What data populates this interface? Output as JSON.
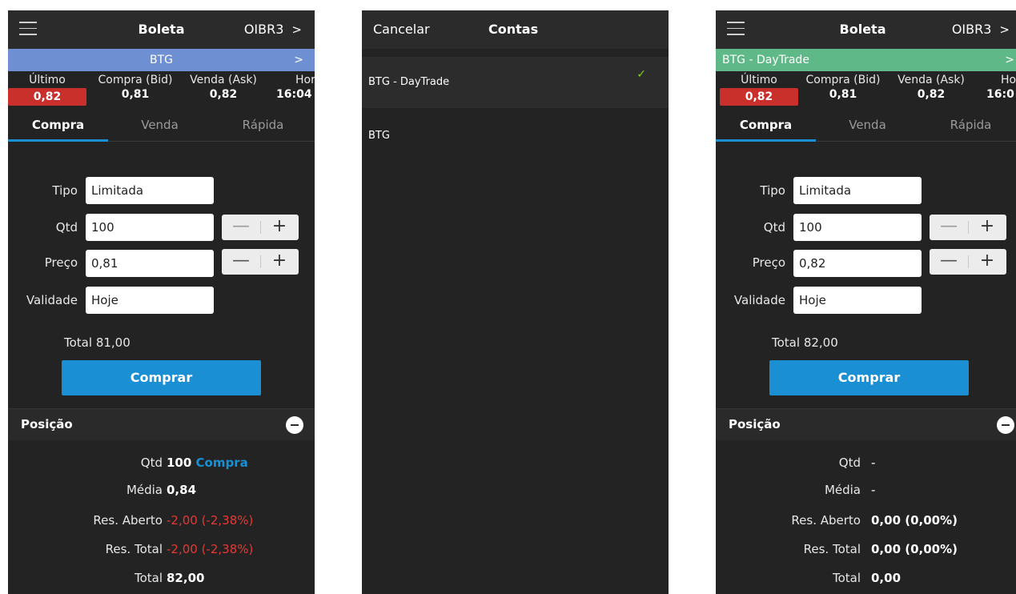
{
  "screen1": {
    "title": "Boleta",
    "ticker": "OIBR3",
    "ticker_chevron": ">",
    "account": "BTG",
    "account_chevron": ">",
    "quotes": {
      "last_label": "Último",
      "last_value": "0,82",
      "bid_label": "Compra (Bid)",
      "bid_value": "0,81",
      "ask_label": "Venda (Ask)",
      "ask_value": "0,82",
      "time_label": "Hor",
      "time_value": "16:04"
    },
    "tabs": [
      "Compra",
      "Venda",
      "Rápida"
    ],
    "form": {
      "tipo_label": "Tipo",
      "tipo_value": "Limitada",
      "qtd_label": "Qtd",
      "qtd_value": "100",
      "preco_label": "Preço",
      "preco_value": "0,81",
      "validade_label": "Validade",
      "validade_value": "Hoje",
      "minus": "—",
      "plus": "+"
    },
    "total_label": "Total",
    "total_value": "81,00",
    "buy_button": "Comprar",
    "position": {
      "title": "Posição",
      "qtd_label": "Qtd",
      "qtd_value": "100",
      "qtd_side": "Compra",
      "media_label": "Média",
      "media_value": "0,84",
      "res_aberto_label": "Res. Aberto",
      "res_aberto_value": "-2,00 (-2,38%)",
      "res_total_label": "Res. Total",
      "res_total_value": "-2,00 (-2,38%)",
      "total_label": "Total",
      "total_value": "82,00"
    }
  },
  "contas": {
    "cancel": "Cancelar",
    "title": "Contas",
    "items": [
      "BTG - DayTrade",
      "BTG"
    ],
    "check": "✓"
  },
  "screen3": {
    "title": "Boleta",
    "ticker": "OIBR3",
    "ticker_chevron": ">",
    "account": "BTG - DayTrade",
    "account_chevron": ">",
    "quotes": {
      "last_label": "Último",
      "last_value": "0,82",
      "bid_label": "Compra (Bid)",
      "bid_value": "0,81",
      "ask_label": "Venda (Ask)",
      "ask_value": "0,82",
      "time_label": "Ho",
      "time_value": "16:0"
    },
    "tabs": [
      "Compra",
      "Venda",
      "Rápida"
    ],
    "form": {
      "tipo_label": "Tipo",
      "tipo_value": "Limitada",
      "qtd_label": "Qtd",
      "qtd_value": "100",
      "preco_label": "Preço",
      "preco_value": "0,82",
      "validade_label": "Validade",
      "validade_value": "Hoje",
      "minus": "—",
      "plus": "+"
    },
    "total_label": "Total",
    "total_value": "82,00",
    "buy_button": "Comprar",
    "position": {
      "title": "Posição",
      "qtd_label": "Qtd",
      "qtd_value": "-",
      "media_label": "Média",
      "media_value": "-",
      "res_aberto_label": "Res. Aberto",
      "res_aberto_value": "0,00 (0,00%)",
      "res_total_label": "Res. Total",
      "res_total_value": "0,00 (0,00%)",
      "total_label": "Total",
      "total_value": "0,00"
    }
  },
  "colors": {
    "background": "#232323",
    "accent_blue": "#1b8fd4",
    "account_blue": "#6f8fd3",
    "account_green": "#5fb887",
    "negative_red": "#e53935",
    "check_green": "#7ed321"
  }
}
